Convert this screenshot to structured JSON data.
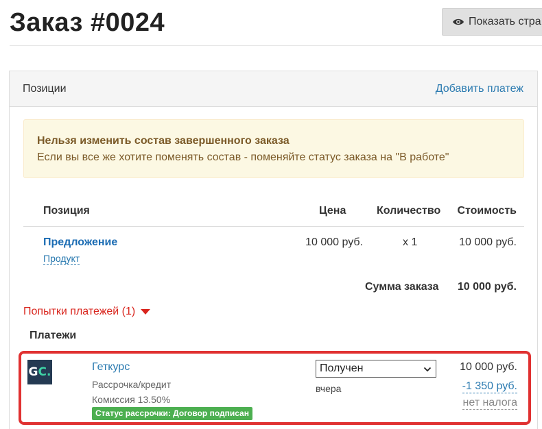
{
  "page": {
    "title": "Заказ #0024",
    "show_page_button": "Показать стра"
  },
  "panel": {
    "title": "Позиции",
    "add_payment": "Добавить платеж",
    "alert": {
      "title": "Нельзя изменить состав завершенного заказа",
      "text": "Если вы все же хотите поменять состав - поменяйте статус заказа на \"В работе\""
    },
    "table": {
      "headers": {
        "position": "Позиция",
        "price": "Цена",
        "quantity": "Количество",
        "cost": "Стоимость"
      },
      "rows": [
        {
          "name": "Предложение",
          "type": "Продукт",
          "price": "10 000 руб.",
          "quantity": "x 1",
          "cost": "10 000 руб."
        }
      ],
      "total_label": "Сумма заказа",
      "total_value": "10 000 руб."
    },
    "payment_attempts": "Попытки платежей (1)",
    "payments_heading": "Платежи",
    "payments": [
      {
        "logo_text_main": "G",
        "logo_text_accent": "C.",
        "provider": "Геткурс",
        "method": "Рассрочка/кредит",
        "commission_text": "Комиссия 13.50%",
        "badge": "Статус рассрочки: Договор подписан",
        "status": "Получен",
        "date": "вчера",
        "amount": "10 000 руб.",
        "commission_amount": "-1 350 руб.",
        "tax": "нет налога"
      }
    ]
  },
  "colors": {
    "link": "#2a7ab0",
    "attempts": "#d9251d",
    "badge": "#4caf50",
    "highlight": "#e03131"
  }
}
